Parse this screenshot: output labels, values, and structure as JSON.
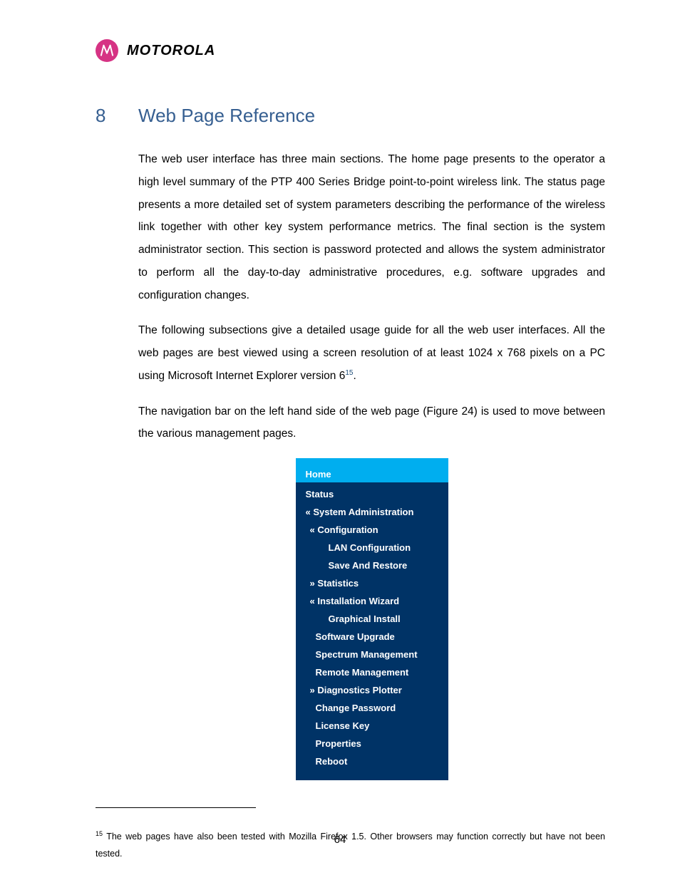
{
  "header": {
    "brand": "MOTOROLA"
  },
  "section": {
    "number": "8",
    "title": "Web Page Reference"
  },
  "paragraphs": {
    "p1": "The web user interface has three main sections. The home page presents to the operator a high level summary of the PTP 400 Series Bridge point-to-point wireless link. The status page presents a more detailed set of system parameters describing the performance of the wireless link together with other key system performance metrics. The final section is the system administrator section. This section is password protected and allows the system administrator to perform all the day-to-day administrative procedures, e.g. software upgrades and configuration changes.",
    "p2a": "The following subsections give a detailed usage guide for all the web user interfaces. All the web pages are best viewed using a screen resolution of at least 1024 x 768 pixels on a PC using Microsoft Internet Explorer version 6",
    "p2sup": "15",
    "p2b": ".",
    "p3": "The navigation bar on the left hand side of the web page (Figure 24) is used to move between the various management pages."
  },
  "nav": {
    "home": "Home",
    "status": "Status",
    "sysadmin": "« System Administration",
    "config": "« Configuration",
    "lan": "LAN Configuration",
    "save": "Save And Restore",
    "stats": "» Statistics",
    "wizard": "« Installation Wizard",
    "graphical": "Graphical Install",
    "upgrade": "Software Upgrade",
    "spectrum": "Spectrum Management",
    "remote": "Remote Management",
    "diag": "» Diagnostics Plotter",
    "changepw": "Change Password",
    "license": "License Key",
    "properties": "Properties",
    "reboot": "Reboot"
  },
  "footnote": {
    "num": "15",
    "text": " The web pages have also been tested with Mozilla Firefox 1.5. Other browsers may function correctly but have not been tested."
  },
  "page_number": "64"
}
